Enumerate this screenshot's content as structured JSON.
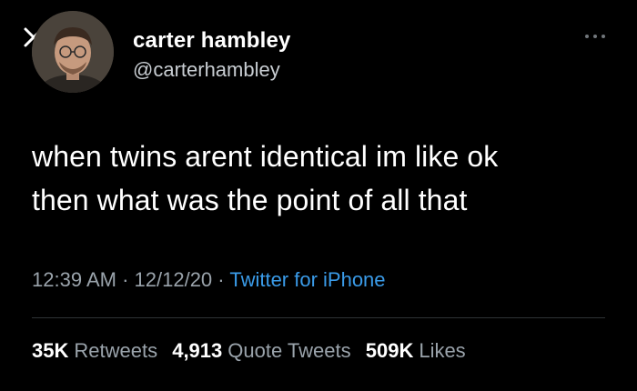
{
  "tweet": {
    "author": {
      "display_name": "carter hambley",
      "handle": "@carterhambley"
    },
    "text_lines": [
      "when twins arent identical im like ok",
      "then what was the point of all that"
    ],
    "time": "12:39 AM",
    "date": "12/12/20",
    "separator": "·",
    "source": "Twitter for iPhone",
    "stats": {
      "retweets": {
        "count": "35K",
        "label": "Retweets"
      },
      "quote_tweets": {
        "count": "4,913",
        "label": "Quote Tweets"
      },
      "likes": {
        "count": "509K",
        "label": "Likes"
      }
    }
  },
  "icons": {
    "close": "close-icon",
    "more": "more-options-icon",
    "avatar": "avatar-photo"
  },
  "colors": {
    "background": "#000000",
    "primary_text": "#ffffff",
    "secondary_text": "#9aa3ab",
    "link": "#3a9be8",
    "divider": "#2f3336"
  }
}
